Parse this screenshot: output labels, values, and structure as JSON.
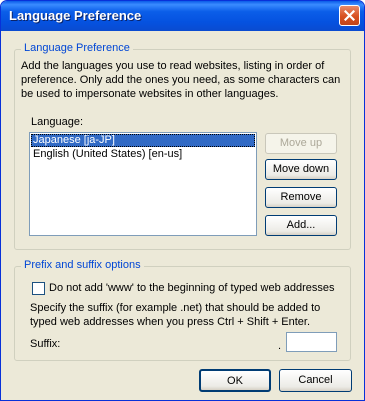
{
  "window": {
    "title": "Language Preference"
  },
  "language_group": {
    "legend": "Language Preference",
    "description_lines": [
      "Add the languages you use to read websites, listing in order of",
      "preference. Only add the ones you need, as some characters can",
      "be used to impersonate websites in other languages."
    ],
    "list_label": "Language:",
    "languages": [
      {
        "label": "Japanese [ja-JP]",
        "selected": true
      },
      {
        "label": "English (United States) [en-us]",
        "selected": false
      }
    ],
    "buttons": {
      "move_up": "Move up",
      "move_down": "Move down",
      "remove": "Remove",
      "add": "Add..."
    }
  },
  "prefix_group": {
    "legend": "Prefix and suffix options",
    "checkbox_label": "Do not add 'www' to the beginning of typed web addresses",
    "checkbox_checked": false,
    "suffix_description_lines": [
      "Specify the suffix (for example .net) that should be added to",
      "typed web addresses when you press Ctrl + Shift + Enter."
    ],
    "suffix_label": "Suffix:",
    "suffix_dot": ".",
    "suffix_value": ""
  },
  "footer": {
    "ok": "OK",
    "cancel": "Cancel"
  },
  "colors": {
    "titlebar": "#0553e0",
    "legend_text": "#0046d5",
    "selection": "#316ac5",
    "close_button": "#d8501f"
  },
  "icons": {
    "close": "close-icon"
  }
}
